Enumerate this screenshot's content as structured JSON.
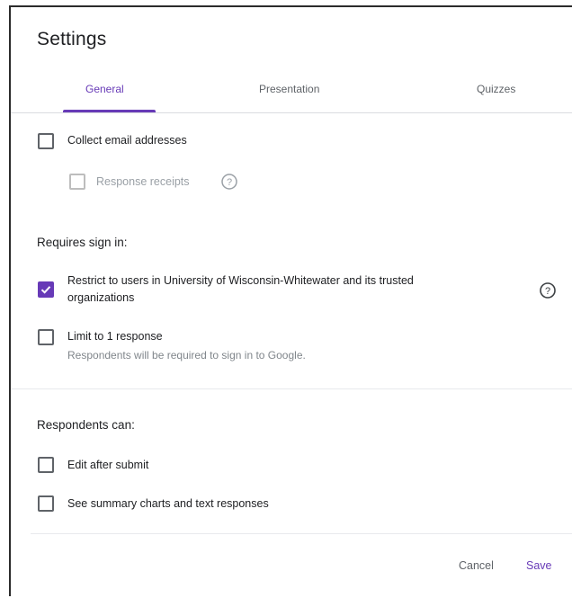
{
  "dialog": {
    "title": "Settings",
    "accent_color": "#673ab7"
  },
  "tabs": [
    {
      "label": "General",
      "active": true
    },
    {
      "label": "Presentation",
      "active": false
    },
    {
      "label": "Quizzes",
      "active": false
    }
  ],
  "general": {
    "collect_email": {
      "label": "Collect email addresses",
      "checked": false
    },
    "response_receipts": {
      "label": "Response receipts",
      "checked": false,
      "disabled": true,
      "icon": "help-icon"
    },
    "requires_sign_in": {
      "heading": "Requires sign in:",
      "restrict_users": {
        "label_line1": "Restrict to users in University of Wisconsin-Whitewater and its trusted",
        "label_line2": "organizations",
        "checked": true,
        "icon": "help-icon"
      },
      "limit_response": {
        "label": "Limit to 1 response",
        "sublabel": "Respondents will be required to sign in to Google.",
        "checked": false
      }
    },
    "respondents_can": {
      "heading": "Respondents can:",
      "edit_after_submit": {
        "label": "Edit after submit",
        "checked": false
      },
      "see_summary": {
        "label": "See summary charts and text responses",
        "checked": false
      }
    }
  },
  "footer": {
    "cancel_label": "Cancel",
    "save_label": "Save"
  }
}
